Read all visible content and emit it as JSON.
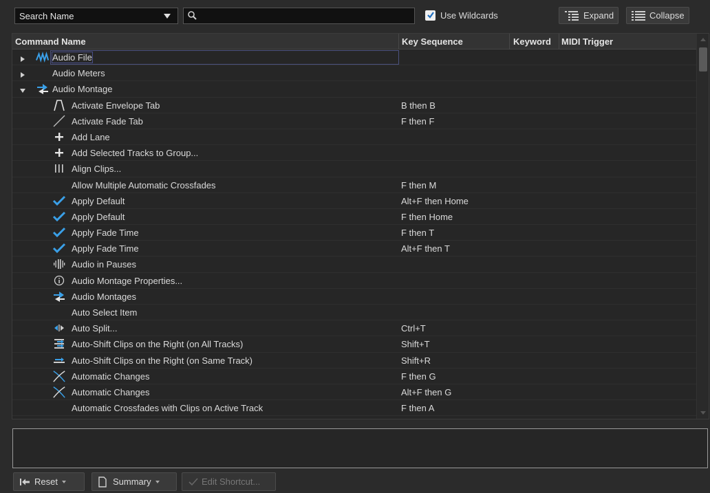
{
  "toolbar": {
    "search_type": "Search Name",
    "search_placeholder": "",
    "use_wildcards_label": "Use Wildcards",
    "use_wildcards_checked": true,
    "expand_label": "Expand",
    "collapse_label": "Collapse"
  },
  "columns": {
    "command_name": "Command Name",
    "key_sequence": "Key Sequence",
    "keyword": "Keyword",
    "midi_trigger": "MIDI Trigger"
  },
  "rows": [
    {
      "name": "Audio File",
      "keys": "",
      "icon": "waveform-icon",
      "level": 0,
      "expander": "collapsed"
    },
    {
      "name": "Audio Meters",
      "keys": "",
      "icon": "",
      "level": 0,
      "expander": "collapsed"
    },
    {
      "name": "Audio Montage",
      "keys": "",
      "icon": "montage-icon",
      "level": 0,
      "expander": "expanded"
    },
    {
      "name": "Activate Envelope Tab",
      "keys": "B then B",
      "icon": "envelope-icon",
      "level": 1
    },
    {
      "name": "Activate Fade Tab",
      "keys": "F then F",
      "icon": "fade-line-icon",
      "level": 1
    },
    {
      "name": "Add Lane",
      "keys": "",
      "icon": "plus-icon",
      "level": 1
    },
    {
      "name": "Add Selected Tracks to Group...",
      "keys": "",
      "icon": "plus-icon",
      "level": 1
    },
    {
      "name": "Align Clips...",
      "keys": "",
      "icon": "align-icon",
      "level": 1
    },
    {
      "name": "Allow Multiple Automatic Crossfades",
      "keys": "F then M",
      "icon": "",
      "level": 1
    },
    {
      "name": "Apply Default",
      "keys": "Alt+F then Home",
      "icon": "checkmark-icon",
      "level": 1
    },
    {
      "name": "Apply Default",
      "keys": "F then Home",
      "icon": "checkmark-icon",
      "level": 1
    },
    {
      "name": "Apply Fade Time",
      "keys": "F then T",
      "icon": "checkmark-icon",
      "level": 1
    },
    {
      "name": "Apply Fade Time",
      "keys": "Alt+F then T",
      "icon": "checkmark-icon",
      "level": 1
    },
    {
      "name": "Audio in Pauses",
      "keys": "",
      "icon": "audio-pauses-icon",
      "level": 1
    },
    {
      "name": "Audio Montage Properties...",
      "keys": "",
      "icon": "info-icon",
      "level": 1
    },
    {
      "name": "Audio Montages",
      "keys": "",
      "icon": "montage-icon",
      "level": 1
    },
    {
      "name": "Auto Select Item",
      "keys": "",
      "icon": "",
      "level": 1
    },
    {
      "name": "Auto Split...",
      "keys": "Ctrl+T",
      "icon": "split-icon",
      "level": 1
    },
    {
      "name": "Auto-Shift Clips on the Right (on All Tracks)",
      "keys": "Shift+T",
      "icon": "shift-all-icon",
      "level": 1
    },
    {
      "name": "Auto-Shift Clips on the Right (on Same Track)",
      "keys": "Shift+R",
      "icon": "shift-same-icon",
      "level": 1
    },
    {
      "name": "Automatic Changes",
      "keys": "F then G",
      "icon": "crossfade-icon",
      "level": 1
    },
    {
      "name": "Automatic Changes",
      "keys": "Alt+F then G",
      "icon": "crossfade-icon",
      "level": 1
    },
    {
      "name": "Automatic Crossfades with Clips on Active Track",
      "keys": "F then A",
      "icon": "",
      "level": 1
    }
  ],
  "description": "",
  "bottom": {
    "reset_label": "Reset",
    "summary_label": "Summary",
    "edit_shortcut_label": "Edit Shortcut..."
  },
  "colors": {
    "accent": "#3aa0e8",
    "background": "#2b2b2b"
  }
}
